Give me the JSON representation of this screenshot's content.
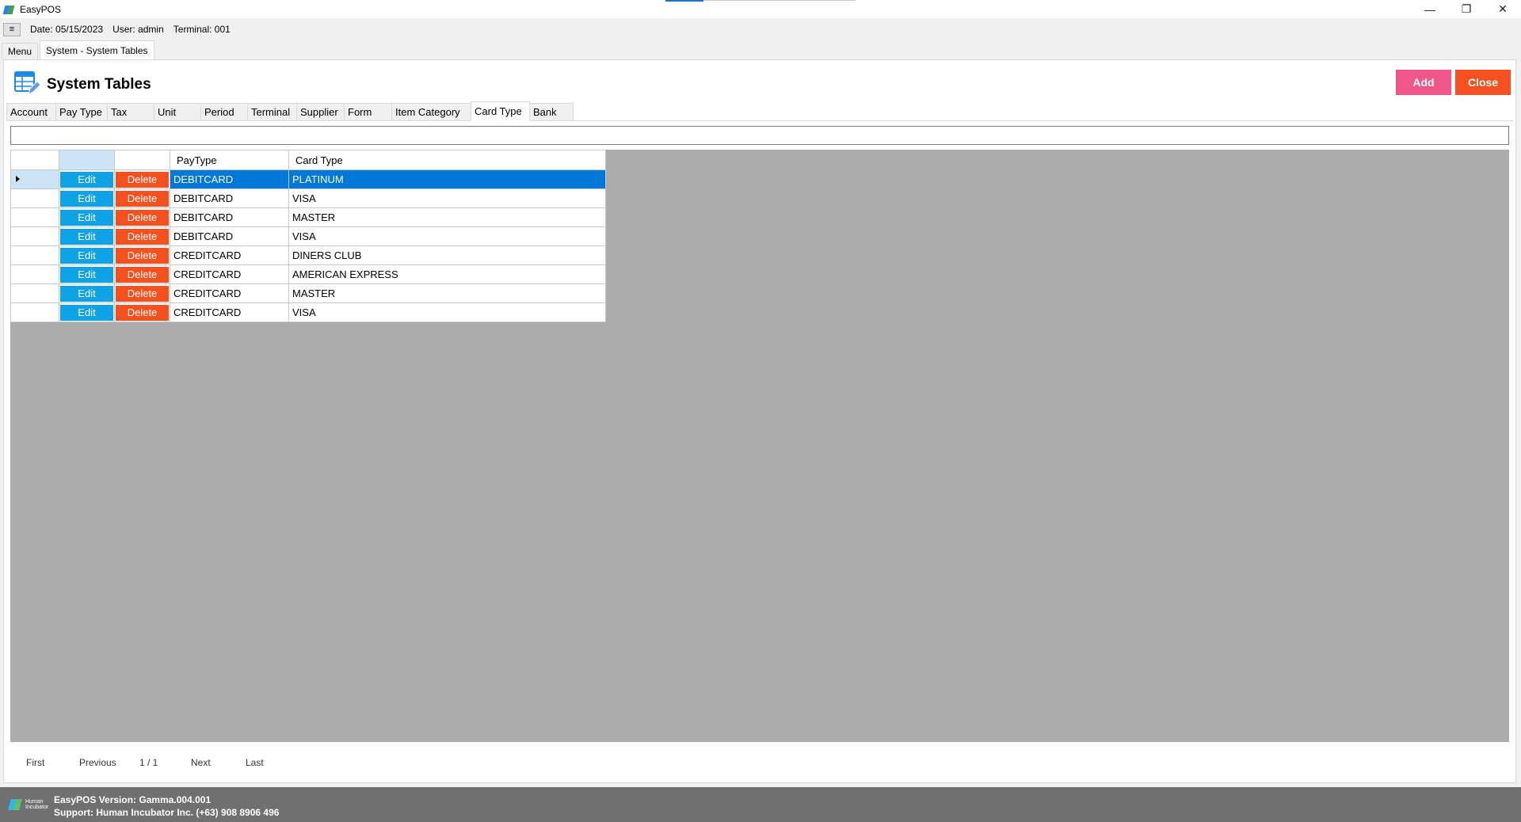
{
  "window": {
    "title": "EasyPOS",
    "controls": [
      "—",
      "❐",
      "✕"
    ]
  },
  "infobar": {
    "menu_glyph": "≡",
    "date": "Date: 05/15/2023",
    "user": "User: admin",
    "terminal": "Terminal: 001"
  },
  "doc_tabs": [
    {
      "label": "Menu",
      "active": false
    },
    {
      "label": "System - System Tables",
      "active": true
    }
  ],
  "page": {
    "title": "System Tables",
    "add_label": "Add",
    "close_label": "Close"
  },
  "section_tabs": [
    {
      "label": "Account",
      "width": 63,
      "active": false
    },
    {
      "label": "Pay Type",
      "width": 66,
      "active": false
    },
    {
      "label": "Tax",
      "width": 60,
      "active": false
    },
    {
      "label": "Unit",
      "width": 60,
      "active": false
    },
    {
      "label": "Period",
      "width": 60,
      "active": false
    },
    {
      "label": "Terminal",
      "width": 63,
      "active": false
    },
    {
      "label": "Supplier",
      "width": 61,
      "active": false
    },
    {
      "label": "Form",
      "width": 61,
      "active": false
    },
    {
      "label": "Item Category",
      "width": 101,
      "active": false
    },
    {
      "label": "Card Type",
      "width": 75,
      "active": true
    },
    {
      "label": "Bank",
      "width": 56,
      "active": false
    }
  ],
  "search": {
    "value": "",
    "placeholder": ""
  },
  "grid": {
    "columns": [
      "",
      "",
      "",
      "PayType",
      "Card Type"
    ],
    "edit_label": "Edit",
    "delete_label": "Delete",
    "rows": [
      {
        "pay_type": "DEBITCARD",
        "card_type": "PLATINUM",
        "selected": true
      },
      {
        "pay_type": "DEBITCARD",
        "card_type": "VISA",
        "selected": false
      },
      {
        "pay_type": "DEBITCARD",
        "card_type": "MASTER",
        "selected": false
      },
      {
        "pay_type": "DEBITCARD",
        "card_type": "VISA",
        "selected": false
      },
      {
        "pay_type": "CREDITCARD",
        "card_type": "DINERS CLUB",
        "selected": false
      },
      {
        "pay_type": "CREDITCARD",
        "card_type": "AMERICAN EXPRESS",
        "selected": false
      },
      {
        "pay_type": "CREDITCARD",
        "card_type": "MASTER",
        "selected": false
      },
      {
        "pay_type": "CREDITCARD",
        "card_type": "VISA",
        "selected": false
      }
    ]
  },
  "pager": {
    "first": "First",
    "previous": "Previous",
    "page_indicator": "1 / 1",
    "next": "Next",
    "last": "Last"
  },
  "footer": {
    "logo_text": "Human Incubator",
    "version": "EasyPOS Version: Gamma.004.001",
    "support": "Support: Human Incubator Inc. (+63) 908 8906 496"
  },
  "colors": {
    "add": "#f0568a",
    "close": "#f5501e",
    "edit": "#0da3e6",
    "delete": "#f5501e",
    "selection": "#0078d7",
    "grid_bg": "#ababab",
    "footer_bg": "#707070"
  },
  "icons": {
    "app": "easypos-logo-icon",
    "header": "table-edit-icon",
    "menu": "hamburger-icon",
    "row_indicator": "caret-right-icon"
  }
}
